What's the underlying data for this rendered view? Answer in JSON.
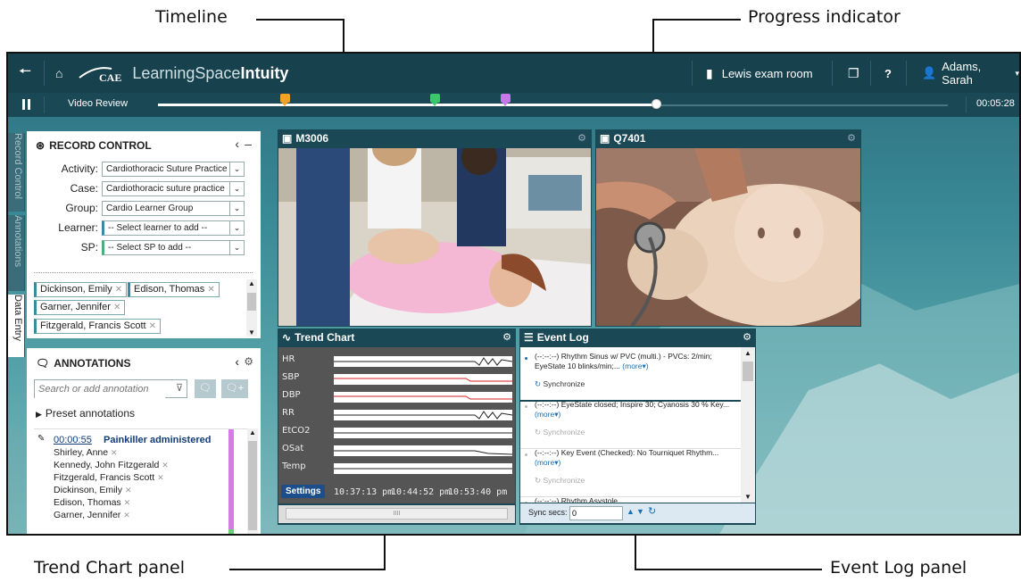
{
  "callouts": {
    "timeline": "Timeline",
    "progress": "Progress indicator",
    "trend": "Trend Chart panel",
    "eventlog": "Event Log panel"
  },
  "topbar": {
    "brand_cae": "CAE",
    "brand_name": "LearningSpace",
    "brand_suffix": "Intuity",
    "room": "Lewis exam room",
    "help": "?",
    "user": "Adams, Sarah"
  },
  "timeline": {
    "label": "Video Review",
    "time": "00:05:28",
    "progress": 0.63,
    "markers": [
      {
        "position": 0.16,
        "color": "#f2a227"
      },
      {
        "position": 0.35,
        "color": "#3cc86a"
      },
      {
        "position": 0.44,
        "color": "#c879e8"
      }
    ]
  },
  "tabs": {
    "record": "Record Control",
    "annotations": "Annotations",
    "data_entry": "Data Entry"
  },
  "record": {
    "title": "RECORD CONTROL",
    "fields": [
      {
        "label": "Activity:",
        "value": "Cardiothoracic Suture Practice"
      },
      {
        "label": "Case:",
        "value": "Cardiothoracic suture practice"
      },
      {
        "label": "Group:",
        "value": "Cardio Learner Group"
      },
      {
        "label": "Learner:",
        "value": "-- Select learner to add --"
      },
      {
        "label": "SP:",
        "value": "-- Select SP to add --"
      }
    ],
    "chips": [
      "Dickinson, Emily",
      "Edison, Thomas",
      "Garner, Jennifer",
      "Fitzgerald, Francis Scott"
    ]
  },
  "annotations": {
    "title": "ANNOTATIONS",
    "placeholder": "Search or add annotation",
    "preset": "Preset annotations",
    "entry_time": "00:00:55",
    "entry_title": "Painkiller administered",
    "people": [
      "Shirley, Anne",
      "Kennedy, John Fitzgerald",
      "Fitzgerald, Francis Scott",
      "Dickinson, Emily",
      "Edison, Thomas",
      "Garner, Jennifer"
    ]
  },
  "cams": [
    {
      "name": "M3006"
    },
    {
      "name": "Q7401"
    }
  ],
  "trend": {
    "title": "Trend Chart",
    "labels": [
      "HR",
      "SBP",
      "DBP",
      "RR",
      "EtCO2",
      "OSat",
      "Temp"
    ],
    "times": [
      "10:37:13 pm",
      "10:44:52 pm",
      "10:53:40 pm"
    ],
    "settings": "Settings",
    "scroll_grip": "IIII"
  },
  "eventlog": {
    "title": "Event Log",
    "items": [
      {
        "line1": "(--:--:--) Rhythm Sinus w/ PVC (multi.) - PVCs: 2/min; EyeState 10 blinks/min;...",
        "more": "(more▾)",
        "sync": "Synchronize",
        "active": true
      },
      {
        "line1": "(--:--:--) EyeState closed; Inspire 30; Cyanosis 30 % Key...",
        "more": "(more▾)",
        "sync": "Synchronize",
        "active": false
      },
      {
        "line1": "(--:--:--) Key Event (Checked): No Tourniquet Rhythm...",
        "more": "(more▾)",
        "sync": "Synchronize",
        "active": false
      },
      {
        "line1": "(--:--:--) Rhythm Asystole",
        "more": "",
        "sync": "",
        "active": false
      }
    ],
    "sync_label": "Sync secs:",
    "sync_value": "0"
  }
}
